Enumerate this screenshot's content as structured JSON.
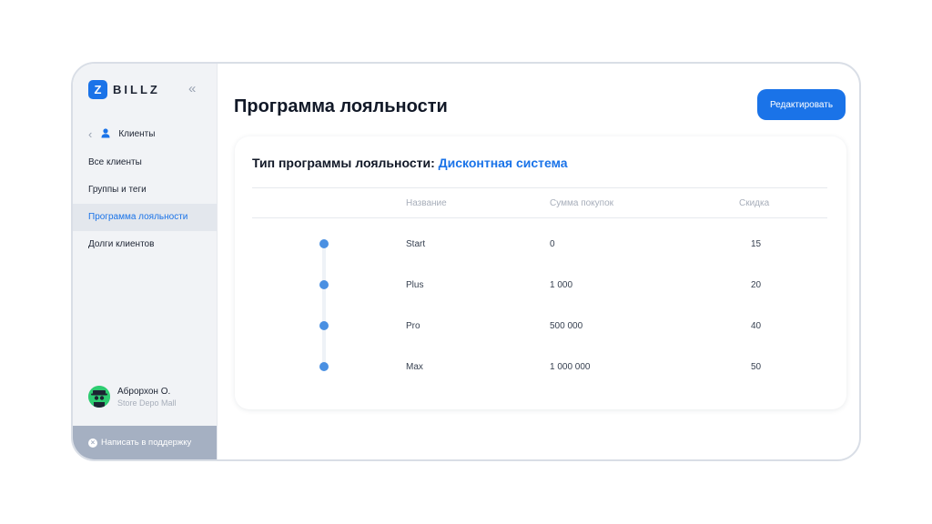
{
  "sidebar": {
    "logo_letter": "Z",
    "logo_text": "BILLZ",
    "collapse_glyph": "«",
    "back_label": "Клиенты",
    "items": [
      {
        "label": "Все клиенты",
        "active": false
      },
      {
        "label": "Группы и теги",
        "active": false
      },
      {
        "label": "Программа лояльности",
        "active": true
      },
      {
        "label": "Долги клиентов",
        "active": false
      }
    ],
    "profile": {
      "name": "Аброрхон О.",
      "store": "Store Depo Mall"
    },
    "support_label": "Написать в поддержку"
  },
  "header": {
    "title": "Программа лояльности",
    "edit_label": "Редактировать"
  },
  "card": {
    "type_label": "Тип программы лояльности:",
    "type_value": "Дисконтная система",
    "columns": [
      "Название",
      "Сумма покупок",
      "Скидка"
    ],
    "rows": [
      {
        "name": "Start",
        "amount": "0",
        "discount": "15"
      },
      {
        "name": "Plus",
        "amount": "1 000",
        "discount": "20"
      },
      {
        "name": "Pro",
        "amount": "500 000",
        "discount": "40"
      },
      {
        "name": "Max",
        "amount": "1 000 000",
        "discount": "50"
      }
    ]
  },
  "colors": {
    "accent": "#1a73e8",
    "timeline_dot": "#4a90e2",
    "sidebar_bg": "#f1f3f6",
    "support_bg": "#a5b0c2"
  },
  "icons": [
    "chevron-left-icon",
    "user-icon",
    "collapse-icon",
    "avatar-icon",
    "close-circle-icon"
  ]
}
